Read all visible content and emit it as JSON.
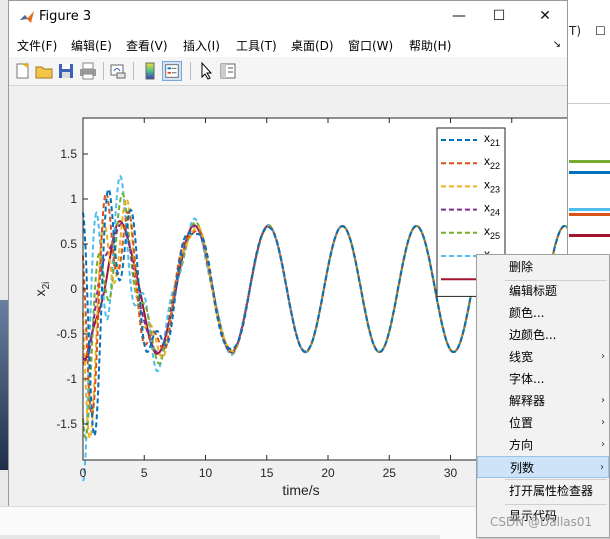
{
  "window": {
    "title": "Figure 3",
    "minimize": "—",
    "maximize": "☐",
    "close": "✕"
  },
  "menu": [
    "文件(F)",
    "编辑(E)",
    "查看(V)",
    "插入(I)",
    "工具(T)",
    "桌面(D)",
    "窗口(W)",
    "帮助(H)"
  ],
  "background_window": {
    "fragment_1": "T)",
    "fragment_2": "☐"
  },
  "toolbar_icons": [
    "new-figure-icon",
    "open-icon",
    "save-icon",
    "print-icon",
    "link-plot-icon",
    "colorbar-icon",
    "legend-icon",
    "pointer-icon",
    "property-editor-icon"
  ],
  "chart_data": {
    "type": "line",
    "xlabel": "time/s",
    "ylabel": "x_2i",
    "xlim": [
      0,
      40
    ],
    "ylim": [
      -1.9,
      1.9
    ],
    "xticks": [
      0,
      5,
      10,
      15,
      20,
      25,
      30,
      35
    ],
    "yticks": [
      -1.5,
      -1,
      -0.5,
      0,
      0.5,
      1,
      1.5
    ],
    "grid": false,
    "legend_position": "top-right",
    "series": [
      {
        "name": "x21",
        "color": "#0072BD",
        "style": "dashed",
        "initial": 0.85
      },
      {
        "name": "x22",
        "color": "#D95319",
        "style": "dashed",
        "initial": 0.6
      },
      {
        "name": "x23",
        "color": "#EDB120",
        "style": "dashed",
        "initial": 0.5
      },
      {
        "name": "x24",
        "color": "#7E2F8E",
        "style": "dashed",
        "initial": -0.5
      },
      {
        "name": "x25",
        "color": "#77AC30",
        "style": "dashed",
        "initial": 0.3
      },
      {
        "name": "x26",
        "color": "#4DBEEE",
        "style": "dashed",
        "initial": 0.75
      },
      {
        "name": "",
        "color": "#A2142F",
        "style": "solid",
        "initial": -0.55
      }
    ],
    "steady_amplitude": 0.7,
    "period": 6.05
  },
  "context_menu": {
    "items": [
      {
        "label": "删除",
        "submenu": false
      },
      {
        "label": "编辑标题",
        "submenu": false
      },
      {
        "label": "颜色...",
        "submenu": false
      },
      {
        "label": "边颜色...",
        "submenu": false
      },
      {
        "label": "线宽",
        "submenu": true
      },
      {
        "label": "字体...",
        "submenu": false
      },
      {
        "label": "解释器",
        "submenu": true
      },
      {
        "label": "位置",
        "submenu": true
      },
      {
        "label": "方向",
        "submenu": true
      },
      {
        "label": "列数",
        "submenu": true,
        "highlighted": true
      },
      {
        "label": "打开属性检查器",
        "submenu": false
      },
      {
        "label": "显示代码",
        "submenu": false
      }
    ],
    "arrow": "›"
  },
  "watermark": "CSDN @Dallas01"
}
